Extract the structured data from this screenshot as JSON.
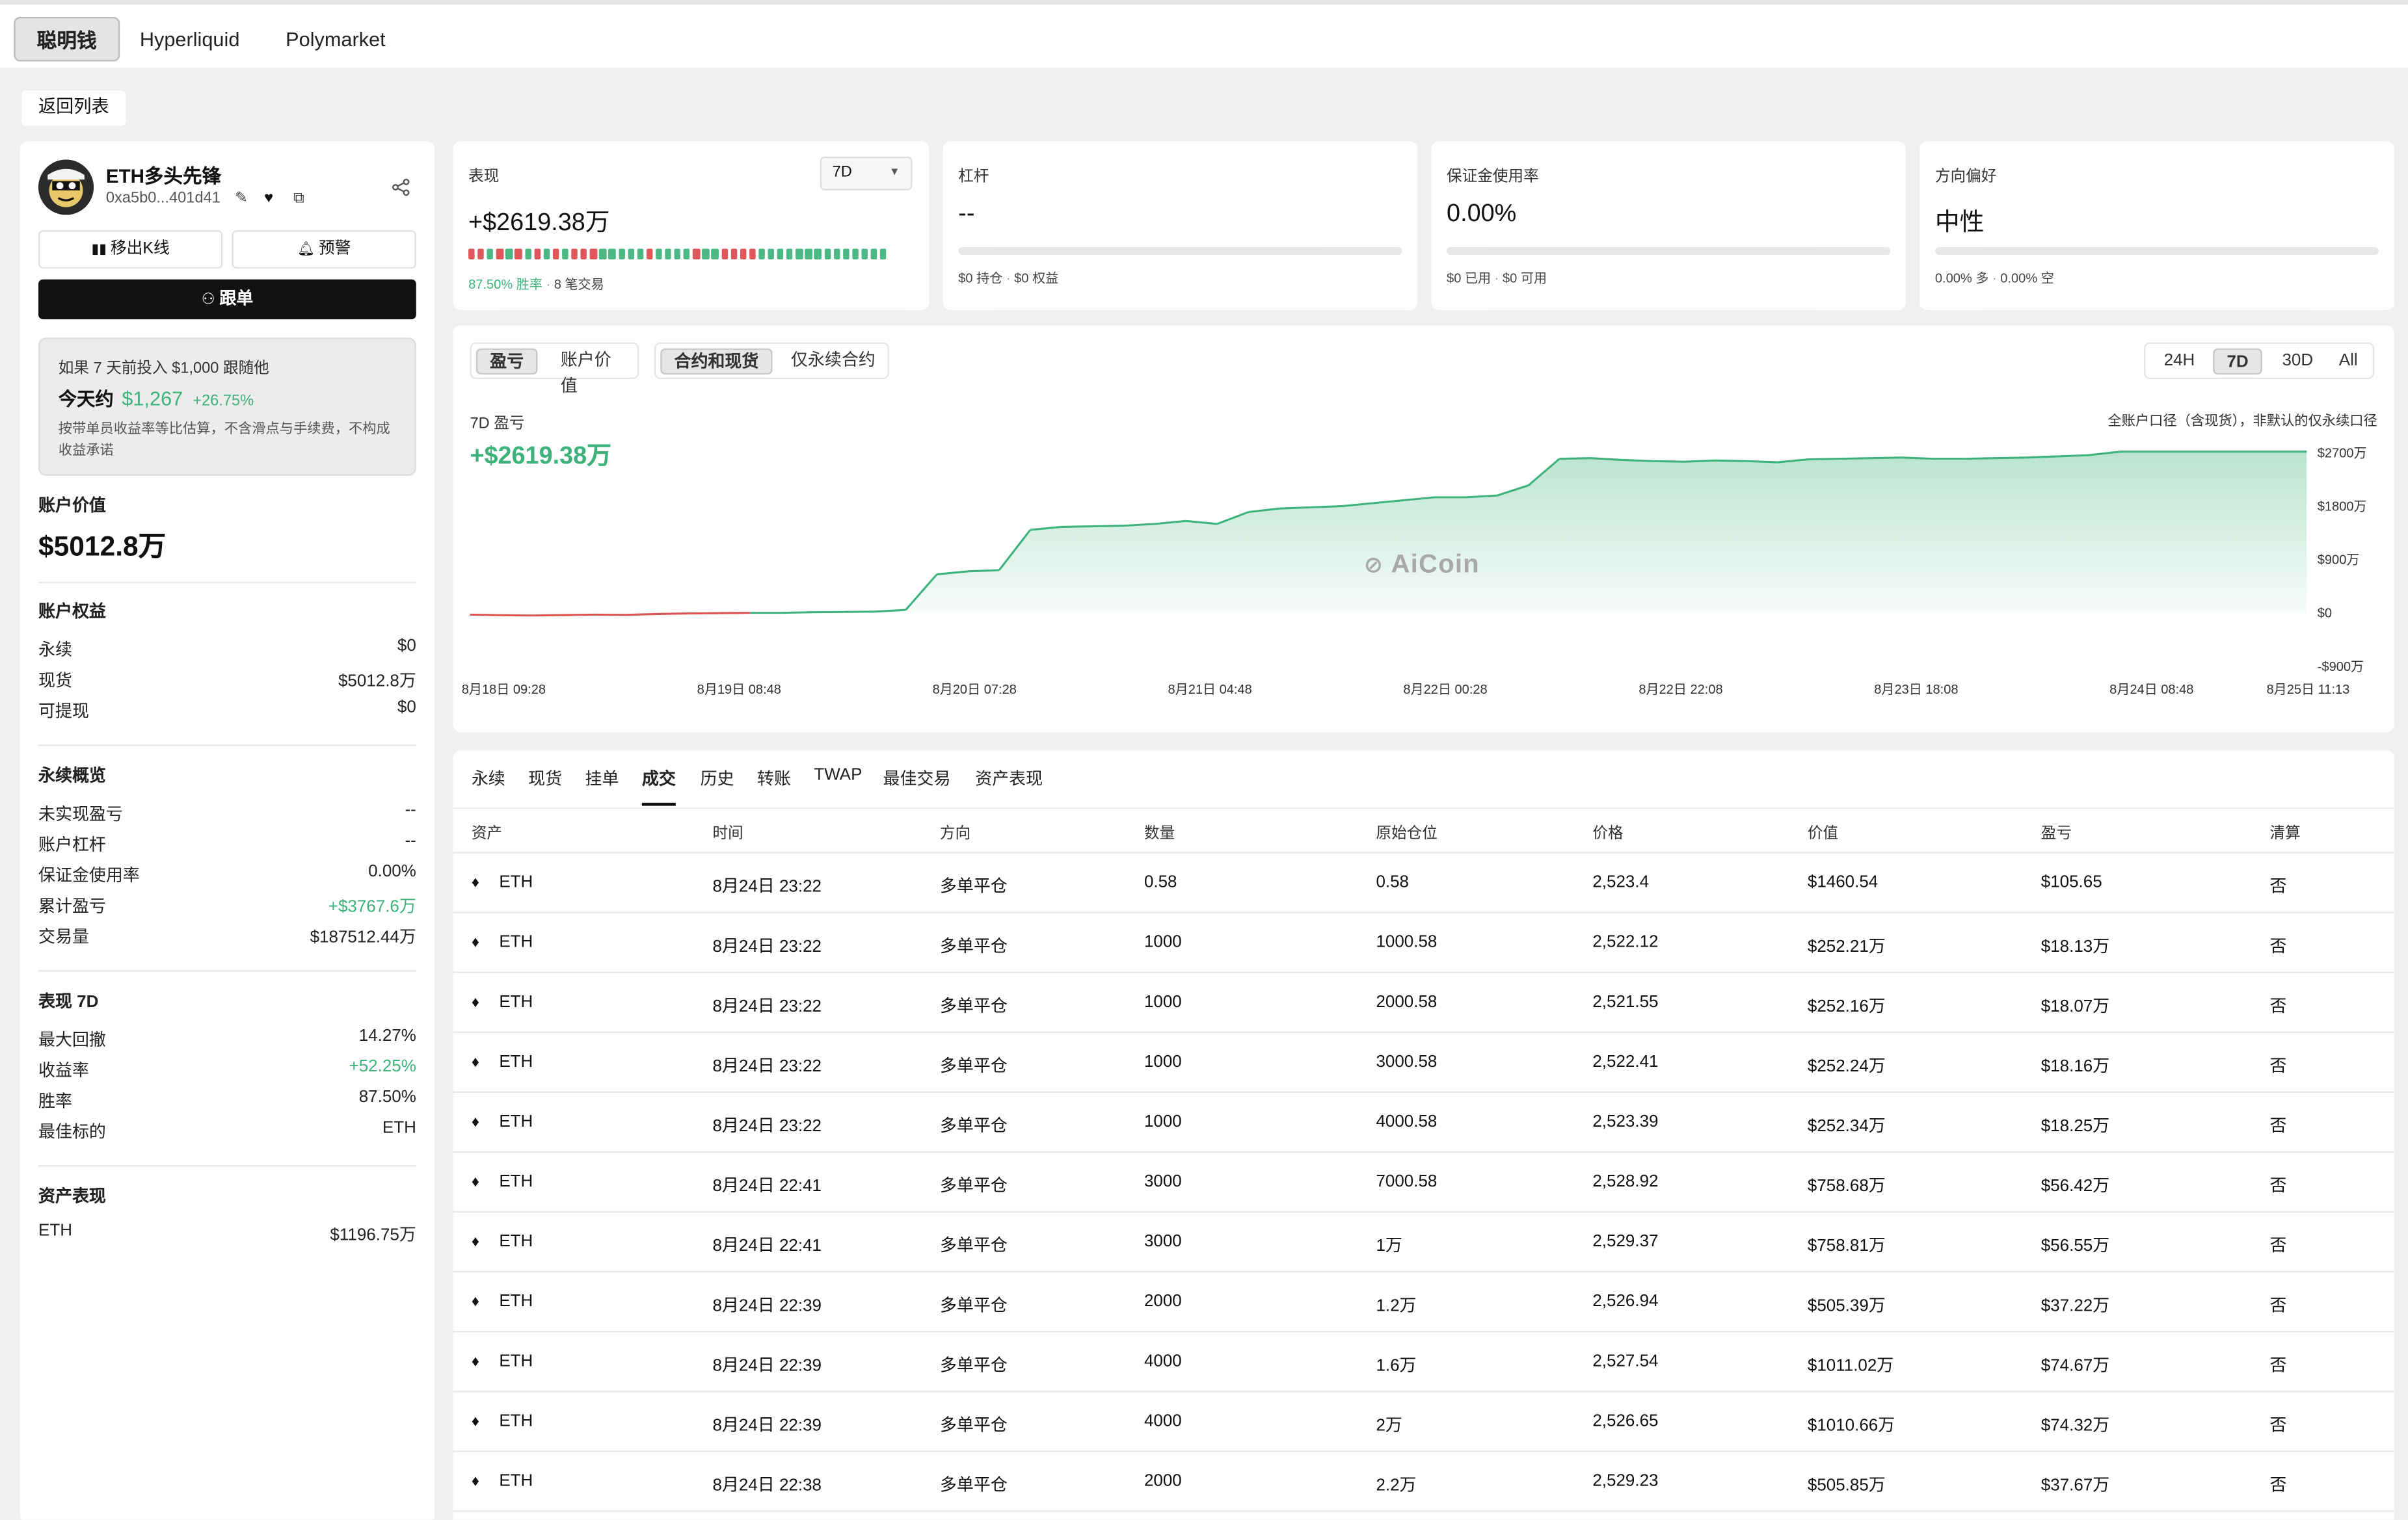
{
  "top_tabs": [
    "聪明钱",
    "Hyperliquid",
    "Polymarket"
  ],
  "back_label": "返回列表",
  "profile": {
    "name": "ETH多头先锋",
    "address": "0xa5b0...401d41",
    "remove_kline_label": "移出K线",
    "alert_label": "预警",
    "follow_label": "跟单"
  },
  "simulation": {
    "line1": "如果 7 天前投入 $1,000 跟随他",
    "today_prefix": "今天约",
    "amount": "$1,267",
    "pct": "+26.75%",
    "disclaimer": "按带单员收益率等比估算，不含滑点与手续费，不构成收益承诺"
  },
  "account": {
    "value_title": "账户价值",
    "value": "$5012.8万",
    "equity_title": "账户权益",
    "equity": [
      {
        "k": "永续",
        "v": "$0"
      },
      {
        "k": "现货",
        "v": "$5012.8万"
      },
      {
        "k": "可提现",
        "v": "$0"
      }
    ],
    "perp_title": "永续概览",
    "perp": [
      {
        "k": "未实现盈亏",
        "v": "--"
      },
      {
        "k": "账户杠杆",
        "v": "--"
      },
      {
        "k": "保证金使用率",
        "v": "0.00%"
      },
      {
        "k": "累计盈亏",
        "v": "+$3767.6万"
      },
      {
        "k": "交易量",
        "v": "$187512.44万"
      }
    ],
    "perf_title": "表现 7D",
    "perf": [
      {
        "k": "最大回撤",
        "v": "14.27%"
      },
      {
        "k": "收益率",
        "v": "+52.25%"
      },
      {
        "k": "胜率",
        "v": "87.50%"
      },
      {
        "k": "最佳标的",
        "v": "ETH"
      }
    ],
    "asset_title": "资产表现",
    "assets": [
      {
        "k": "ETH",
        "v": "$1196.75万"
      }
    ]
  },
  "cards": {
    "performance": {
      "label": "表现",
      "period": "7D",
      "value": "+$2619.38万",
      "win_rate": "87.50% 胜率",
      "trades": "8 笔交易",
      "segments": [
        "r",
        "r",
        "g",
        "r",
        "g",
        "r",
        "g",
        "r",
        "g",
        "r",
        "g",
        "r",
        "r",
        "r",
        "g",
        "g",
        "g",
        "g",
        "g",
        "r",
        "g",
        "g",
        "g",
        "g",
        "r",
        "g",
        "g",
        "r",
        "r",
        "r",
        "r",
        "g",
        "g",
        "g",
        "g",
        "g",
        "g",
        "g",
        "g",
        "g",
        "g",
        "g",
        "g",
        "g",
        "g"
      ]
    },
    "leverage": {
      "label": "杠杆",
      "value": "--",
      "sub1": "$0 持仓",
      "sub2": "$0 权益",
      "fill": 0
    },
    "margin": {
      "label": "保证金使用率",
      "value": "0.00%",
      "sub1": "$0 已用",
      "sub2": "$0 可用",
      "fill": 0
    },
    "direction": {
      "label": "方向偏好",
      "value": "中性",
      "sub1": "0.00% 多",
      "sub2": "0.00% 空",
      "fill": 0
    }
  },
  "chart_controls": {
    "tabs1": [
      "盈亏",
      "账户价值"
    ],
    "tabs2": [
      "合约和现货",
      "仅永续合约"
    ],
    "ranges": [
      "24H",
      "7D",
      "30D",
      "All"
    ],
    "active_range": "7D"
  },
  "chart_data": {
    "type": "area",
    "title": "7D 盈亏",
    "big_value": "+$2619.38万",
    "note": "全账户口径（含现货），非默认的仅永续口径",
    "watermark": "AiCoin",
    "ylim": [
      -900,
      2700
    ],
    "y_ticks": [
      "$2700万",
      "$1800万",
      "$900万",
      "$0",
      "-$900万"
    ],
    "y_tick_values": [
      2700,
      1800,
      900,
      0,
      -900
    ],
    "x_ticks": [
      "8月18日 09:28",
      "8月19日 08:48",
      "8月20日 07:28",
      "8月21日 04:48",
      "8月22日 00:28",
      "8月22日 22:08",
      "8月23日 18:08",
      "8月24日 08:48",
      "8月25日 11:13"
    ],
    "series": [
      {
        "values": [
          -30,
          -40,
          -45,
          -38,
          -30,
          -35,
          -20,
          -10,
          -5,
          0,
          0,
          10,
          15,
          20,
          50,
          650,
          700,
          720,
          1400,
          1450,
          1460,
          1470,
          1500,
          1550,
          1500,
          1700,
          1760,
          1780,
          1800,
          1850,
          1900,
          1950,
          1950,
          1980,
          2150,
          2600,
          2610,
          2580,
          2560,
          2550,
          2570,
          2560,
          2540,
          2590,
          2600,
          2610,
          2620,
          2600,
          2600,
          2610,
          2620,
          2640,
          2660,
          2720,
          2720,
          2720,
          2720,
          2720,
          2720,
          2720
        ]
      }
    ]
  },
  "table": {
    "tabs": [
      "永续",
      "现货",
      "挂单",
      "成交",
      "历史",
      "转账",
      "TWAP",
      "最佳交易",
      "资产表现"
    ],
    "active_tab": "成交",
    "headers": [
      "资产",
      "时间",
      "方向",
      "数量",
      "原始仓位",
      "价格",
      "价值",
      "盈亏",
      "清算"
    ],
    "rows": [
      [
        "ETH",
        "8月24日 23:22",
        "多单平仓",
        "0.58",
        "0.58",
        "2,523.4",
        "$1460.54",
        "$105.65",
        "否"
      ],
      [
        "ETH",
        "8月24日 23:22",
        "多单平仓",
        "1000",
        "1000.58",
        "2,522.12",
        "$252.21万",
        "$18.13万",
        "否"
      ],
      [
        "ETH",
        "8月24日 23:22",
        "多单平仓",
        "1000",
        "2000.58",
        "2,521.55",
        "$252.16万",
        "$18.07万",
        "否"
      ],
      [
        "ETH",
        "8月24日 23:22",
        "多单平仓",
        "1000",
        "3000.58",
        "2,522.41",
        "$252.24万",
        "$18.16万",
        "否"
      ],
      [
        "ETH",
        "8月24日 23:22",
        "多单平仓",
        "1000",
        "4000.58",
        "2,523.39",
        "$252.34万",
        "$18.25万",
        "否"
      ],
      [
        "ETH",
        "8月24日 22:41",
        "多单平仓",
        "3000",
        "7000.58",
        "2,528.92",
        "$758.68万",
        "$56.42万",
        "否"
      ],
      [
        "ETH",
        "8月24日 22:41",
        "多单平仓",
        "3000",
        "1万",
        "2,529.37",
        "$758.81万",
        "$56.55万",
        "否"
      ],
      [
        "ETH",
        "8月24日 22:39",
        "多单平仓",
        "2000",
        "1.2万",
        "2,526.94",
        "$505.39万",
        "$37.22万",
        "否"
      ],
      [
        "ETH",
        "8月24日 22:39",
        "多单平仓",
        "4000",
        "1.6万",
        "2,527.54",
        "$1011.02万",
        "$74.67万",
        "否"
      ],
      [
        "ETH",
        "8月24日 22:39",
        "多单平仓",
        "4000",
        "2万",
        "2,526.65",
        "$1010.66万",
        "$74.32万",
        "否"
      ],
      [
        "ETH",
        "8月24日 22:38",
        "多单平仓",
        "2000",
        "2.2万",
        "2,529.23",
        "$505.85万",
        "$37.67万",
        "否"
      ]
    ]
  }
}
